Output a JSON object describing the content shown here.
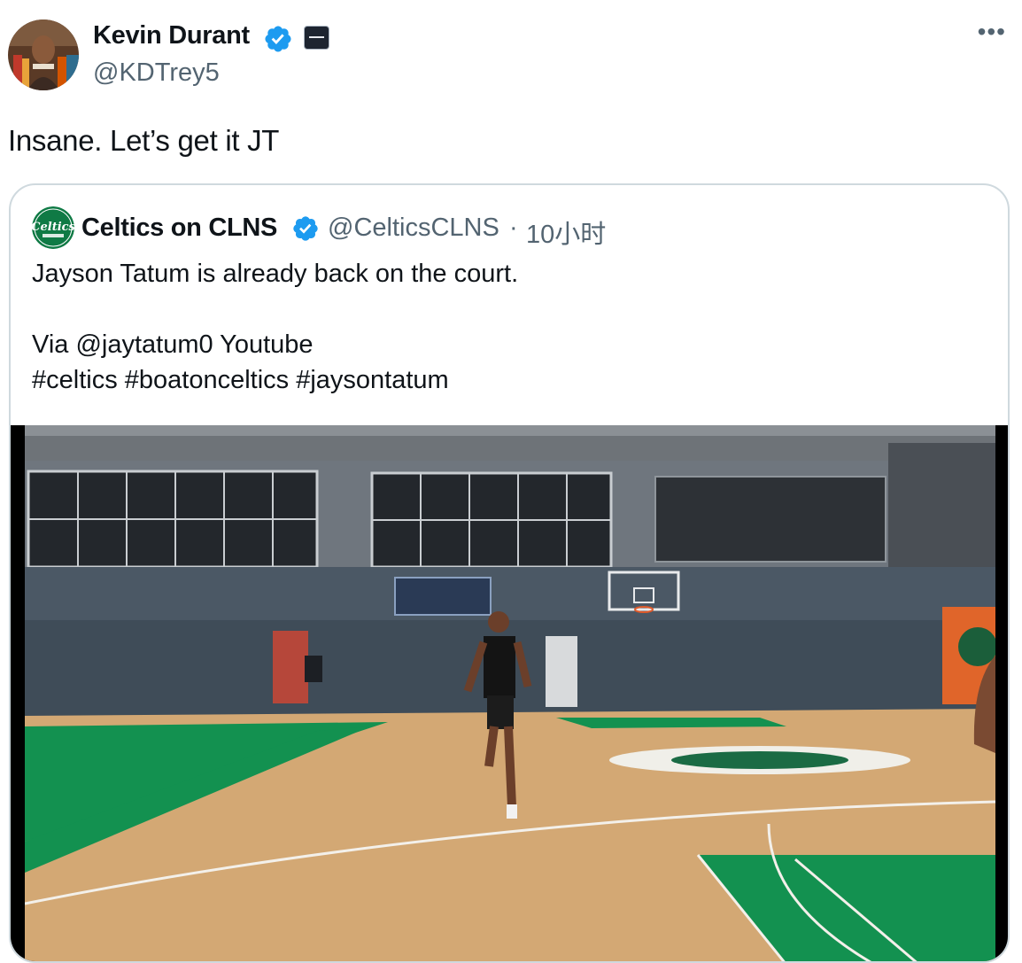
{
  "tweet": {
    "author_name": "Kevin Durant",
    "author_handle": "@KDTrey5",
    "more_label": "•••",
    "text": "Insane. Let’s get it JT"
  },
  "quoted": {
    "author_name": "Celtics on CLNS",
    "author_handle": "@CelticsCLNS",
    "separator": "·",
    "timestamp": "10小时",
    "lines": [
      "Jayson Tatum is already back on the court.",
      "Via @jaytatum0 Youtube",
      "#celtics #boatonceltics #jaysontatum"
    ],
    "avatar_logo_text": "Celtics"
  },
  "colors": {
    "verified": "#1d9bf0",
    "secondary_text": "#536471",
    "quote_border": "#cfd9de",
    "court_green": "#0f8a4a"
  }
}
